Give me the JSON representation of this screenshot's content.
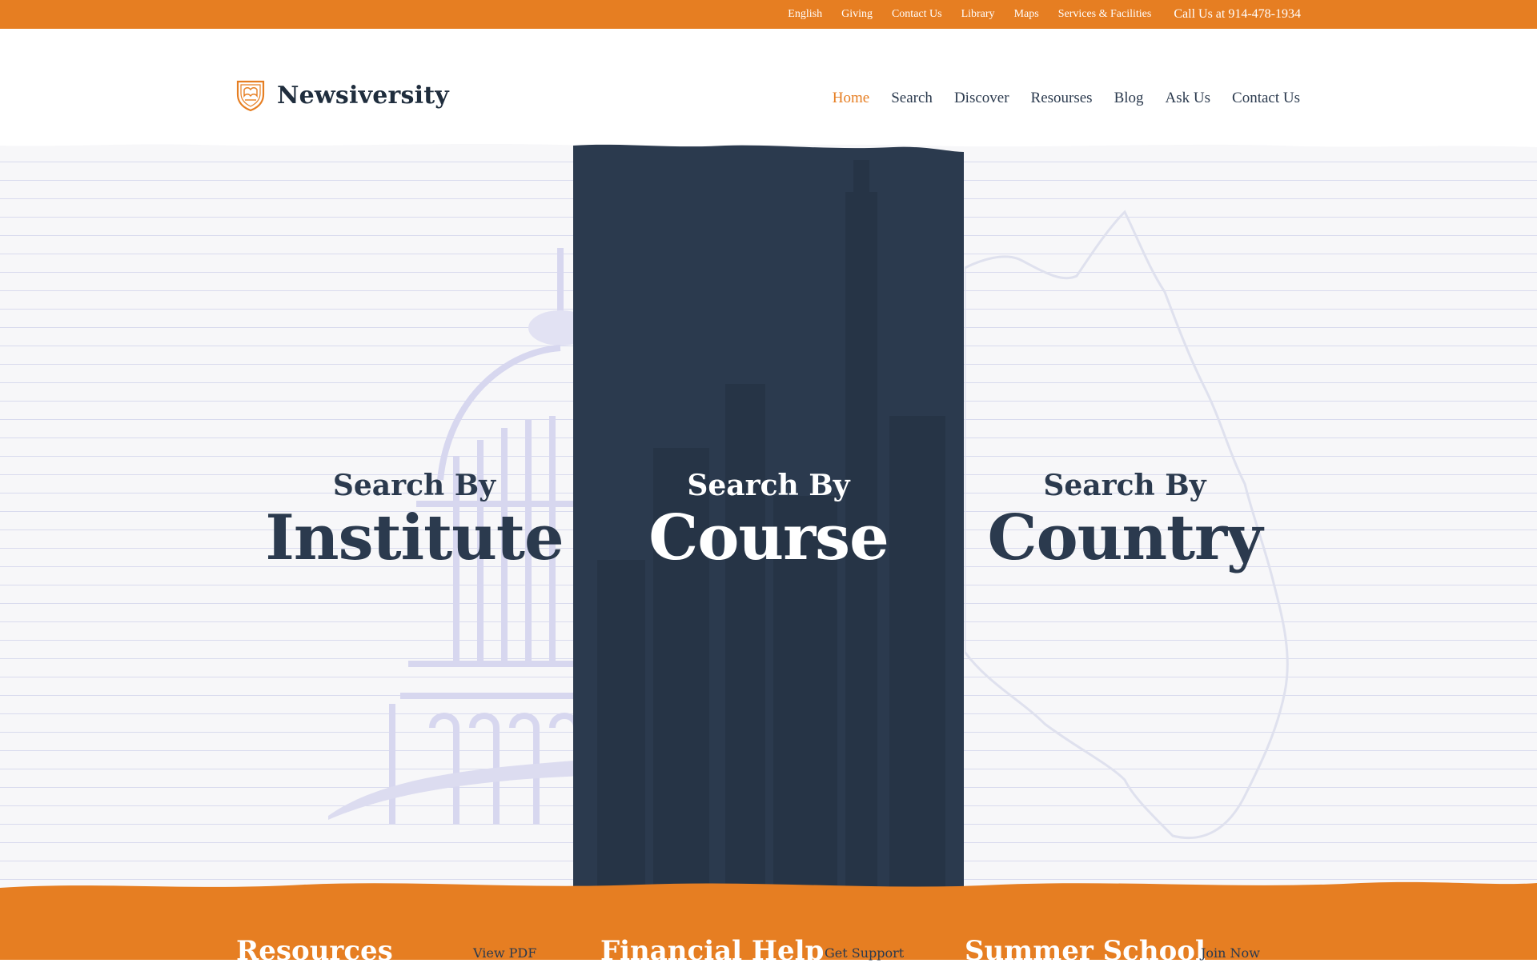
{
  "topbar": {
    "links": [
      "English",
      "Giving",
      "Contact Us",
      "Library",
      "Maps",
      "Services & Facilities"
    ],
    "phone": "Call Us at 914-478-1934"
  },
  "brand": {
    "name": "Newsiversity",
    "logo_icon": "shield-crest-icon"
  },
  "nav": {
    "items": [
      "Home",
      "Search",
      "Discover",
      "Resourses",
      "Blog",
      "Ask Us",
      "Contact Us"
    ],
    "active": "Home"
  },
  "hero": {
    "institute": {
      "prefix": "Search By",
      "label": "Institute"
    },
    "course": {
      "prefix": "Search By",
      "label": "Course"
    },
    "country": {
      "prefix": "Search By",
      "label": "Country"
    }
  },
  "promos": [
    {
      "title": "Resources",
      "button": "View PDF"
    },
    {
      "title": "Financial Help",
      "button": "Get Support"
    },
    {
      "title": "Summer School",
      "button": "Join Now"
    }
  ],
  "colors": {
    "accent": "#e67e22",
    "dark": "#2b3a4e",
    "paper": "#f7f7f9",
    "lines": "#d9dbee"
  }
}
